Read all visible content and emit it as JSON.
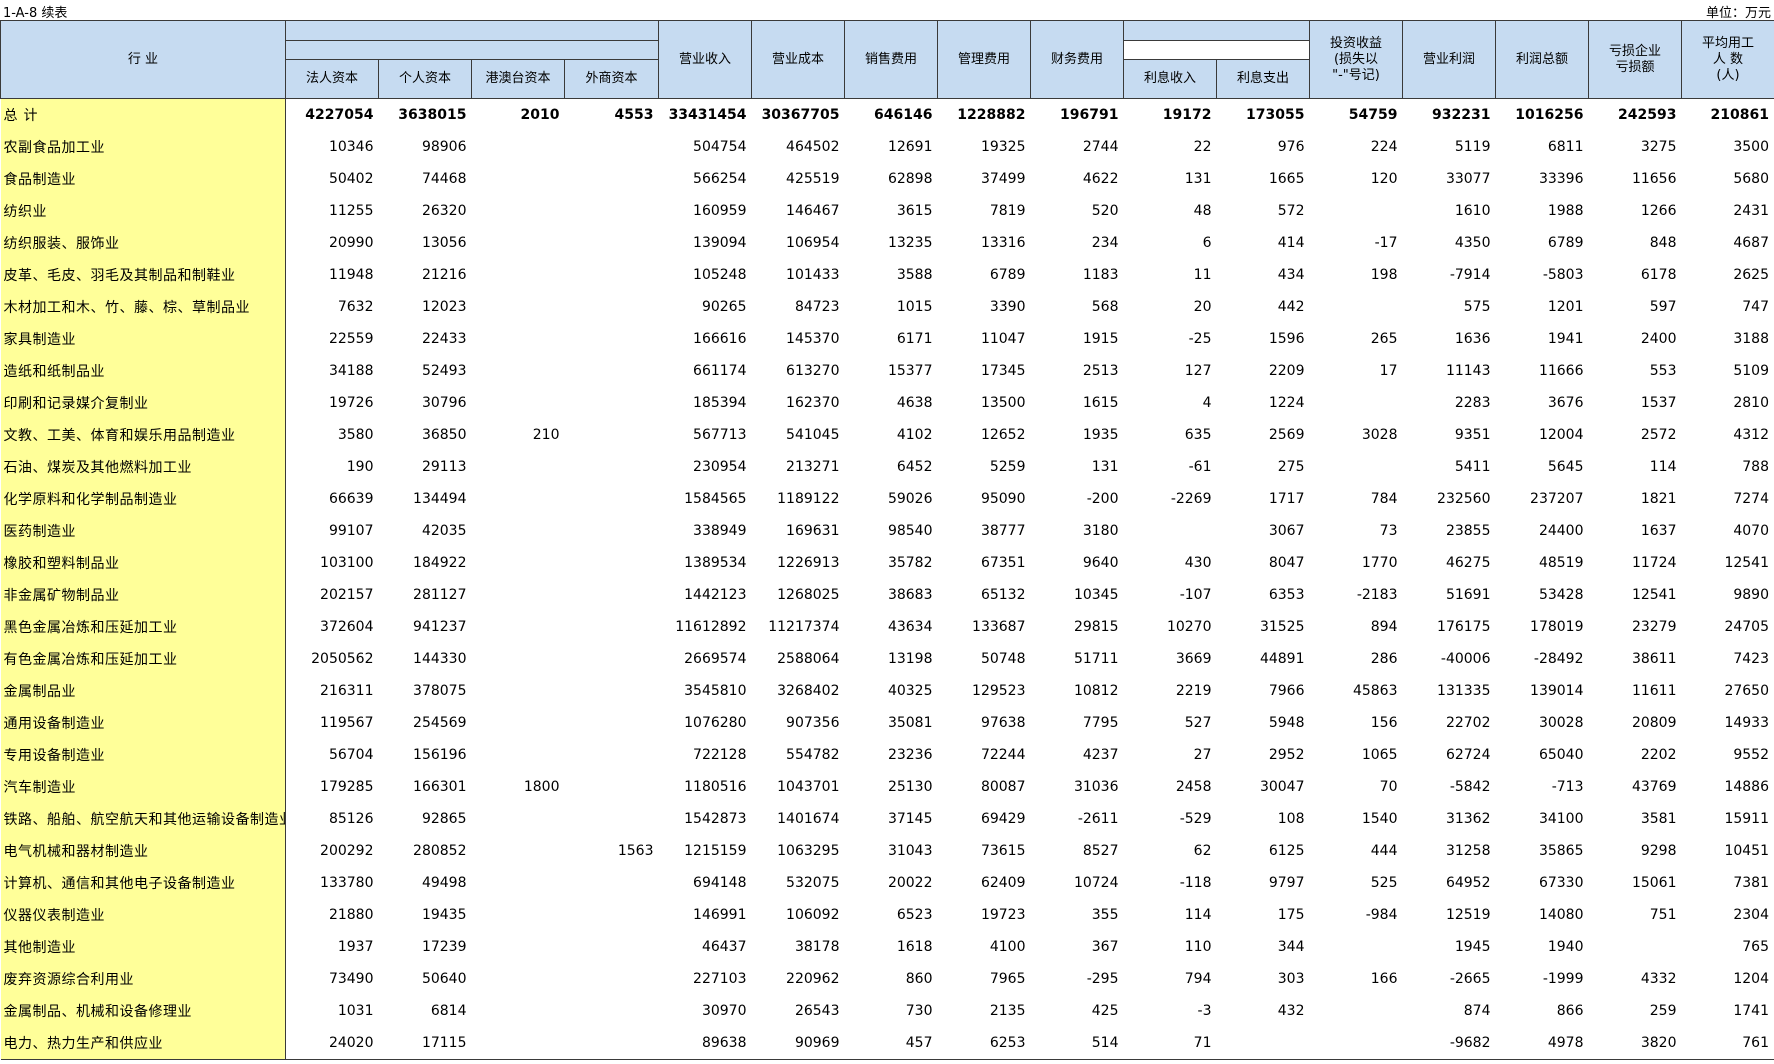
{
  "table_id": "1-A-8  续表",
  "unit": "单位：万元",
  "headers": {
    "industry": "行  业",
    "sub": [
      "法人资本",
      "个人资本",
      "港澳台资本",
      "外商资本"
    ],
    "revenue": "营业收入",
    "cost": "营业成本",
    "sales_exp": "销售费用",
    "mgmt_exp": "管理费用",
    "fin_exp": "财务费用",
    "interest_income": "利息收入",
    "interest_exp": "利息支出",
    "invest_line1": "投资收益",
    "invest_line2": "(损失以",
    "invest_line3": "\"-\"号记)",
    "op_profit": "营业利润",
    "total_profit": "利润总额",
    "loss_line1": "亏损企业",
    "loss_line2": "亏损额",
    "emp_line1": "平均用工",
    "emp_line2": "人  数",
    "emp_line3": "(人)"
  },
  "rows": [
    [
      "总计",
      "4227054",
      "3638015",
      "2010",
      "4553",
      "33431454",
      "30367705",
      "646146",
      "1228882",
      "196791",
      "19172",
      "173055",
      "54759",
      "932231",
      "1016256",
      "242593",
      "210861"
    ],
    [
      "农副食品加工业",
      "10346",
      "98906",
      "",
      "",
      "504754",
      "464502",
      "12691",
      "19325",
      "2744",
      "22",
      "976",
      "224",
      "5119",
      "6811",
      "3275",
      "3500"
    ],
    [
      "食品制造业",
      "50402",
      "74468",
      "",
      "",
      "566254",
      "425519",
      "62898",
      "37499",
      "4622",
      "131",
      "1665",
      "120",
      "33077",
      "33396",
      "11656",
      "5680"
    ],
    [
      "纺织业",
      "11255",
      "26320",
      "",
      "",
      "160959",
      "146467",
      "3615",
      "7819",
      "520",
      "48",
      "572",
      "",
      "1610",
      "1988",
      "1266",
      "2431"
    ],
    [
      "纺织服装、服饰业",
      "20990",
      "13056",
      "",
      "",
      "139094",
      "106954",
      "13235",
      "13316",
      "234",
      "6",
      "414",
      "-17",
      "4350",
      "6789",
      "848",
      "4687"
    ],
    [
      "皮革、毛皮、羽毛及其制品和制鞋业",
      "11948",
      "21216",
      "",
      "",
      "105248",
      "101433",
      "3588",
      "6789",
      "1183",
      "11",
      "434",
      "198",
      "-7914",
      "-5803",
      "6178",
      "2625"
    ],
    [
      "木材加工和木、竹、藤、棕、草制品业",
      "7632",
      "12023",
      "",
      "",
      "90265",
      "84723",
      "1015",
      "3390",
      "568",
      "20",
      "442",
      "",
      "575",
      "1201",
      "597",
      "747"
    ],
    [
      "家具制造业",
      "22559",
      "22433",
      "",
      "",
      "166616",
      "145370",
      "6171",
      "11047",
      "1915",
      "-25",
      "1596",
      "265",
      "1636",
      "1941",
      "2400",
      "3188"
    ],
    [
      "造纸和纸制品业",
      "34188",
      "52493",
      "",
      "",
      "661174",
      "613270",
      "15377",
      "17345",
      "2513",
      "127",
      "2209",
      "17",
      "11143",
      "11666",
      "553",
      "5109"
    ],
    [
      "印刷和记录媒介复制业",
      "19726",
      "30796",
      "",
      "",
      "185394",
      "162370",
      "4638",
      "13500",
      "1615",
      "4",
      "1224",
      "",
      "2283",
      "3676",
      "1537",
      "2810"
    ],
    [
      "文教、工美、体育和娱乐用品制造业",
      "3580",
      "36850",
      "210",
      "",
      "567713",
      "541045",
      "4102",
      "12652",
      "1935",
      "635",
      "2569",
      "3028",
      "9351",
      "12004",
      "2572",
      "4312"
    ],
    [
      "石油、煤炭及其他燃料加工业",
      "190",
      "29113",
      "",
      "",
      "230954",
      "213271",
      "6452",
      "5259",
      "131",
      "-61",
      "275",
      "",
      "5411",
      "5645",
      "114",
      "788"
    ],
    [
      "化学原料和化学制品制造业",
      "66639",
      "134494",
      "",
      "",
      "1584565",
      "1189122",
      "59026",
      "95090",
      "-200",
      "-2269",
      "1717",
      "784",
      "232560",
      "237207",
      "1821",
      "7274"
    ],
    [
      "医药制造业",
      "99107",
      "42035",
      "",
      "",
      "338949",
      "169631",
      "98540",
      "38777",
      "3180",
      "",
      "3067",
      "73",
      "23855",
      "24400",
      "1637",
      "4070"
    ],
    [
      "橡胶和塑料制品业",
      "103100",
      "184922",
      "",
      "",
      "1389534",
      "1226913",
      "35782",
      "67351",
      "9640",
      "430",
      "8047",
      "1770",
      "46275",
      "48519",
      "11724",
      "12541"
    ],
    [
      "非金属矿物制品业",
      "202157",
      "281127",
      "",
      "",
      "1442123",
      "1268025",
      "38683",
      "65132",
      "10345",
      "-107",
      "6353",
      "-2183",
      "51691",
      "53428",
      "12541",
      "9890"
    ],
    [
      "黑色金属冶炼和压延加工业",
      "372604",
      "941237",
      "",
      "",
      "11612892",
      "11217374",
      "43634",
      "133687",
      "29815",
      "10270",
      "31525",
      "894",
      "176175",
      "178019",
      "23279",
      "24705"
    ],
    [
      "有色金属冶炼和压延加工业",
      "2050562",
      "144330",
      "",
      "",
      "2669574",
      "2588064",
      "13198",
      "50748",
      "51711",
      "3669",
      "44891",
      "286",
      "-40006",
      "-28492",
      "38611",
      "7423"
    ],
    [
      "金属制品业",
      "216311",
      "378075",
      "",
      "",
      "3545810",
      "3268402",
      "40325",
      "129523",
      "10812",
      "2219",
      "7966",
      "45863",
      "131335",
      "139014",
      "11611",
      "27650"
    ],
    [
      "通用设备制造业",
      "119567",
      "254569",
      "",
      "",
      "1076280",
      "907356",
      "35081",
      "97638",
      "7795",
      "527",
      "5948",
      "156",
      "22702",
      "30028",
      "20809",
      "14933"
    ],
    [
      "专用设备制造业",
      "56704",
      "156196",
      "",
      "",
      "722128",
      "554782",
      "23236",
      "72244",
      "4237",
      "27",
      "2952",
      "1065",
      "62724",
      "65040",
      "2202",
      "9552"
    ],
    [
      "汽车制造业",
      "179285",
      "166301",
      "1800",
      "",
      "1180516",
      "1043701",
      "25130",
      "80087",
      "31036",
      "2458",
      "30047",
      "70",
      "-5842",
      "-713",
      "43769",
      "14886"
    ],
    [
      "铁路、船舶、航空航天和其他运输设备制造业",
      "85126",
      "92865",
      "",
      "",
      "1542873",
      "1401674",
      "37145",
      "69429",
      "-2611",
      "-529",
      "108",
      "1540",
      "31362",
      "34100",
      "3581",
      "15911"
    ],
    [
      "电气机械和器材制造业",
      "200292",
      "280852",
      "",
      "1563",
      "1215159",
      "1063295",
      "31043",
      "73615",
      "8527",
      "62",
      "6125",
      "444",
      "31258",
      "35865",
      "9298",
      "10451"
    ],
    [
      "计算机、通信和其他电子设备制造业",
      "133780",
      "49498",
      "",
      "",
      "694148",
      "532075",
      "20022",
      "62409",
      "10724",
      "-118",
      "9797",
      "525",
      "64952",
      "67330",
      "15061",
      "7381"
    ],
    [
      "仪器仪表制造业",
      "21880",
      "19435",
      "",
      "",
      "146991",
      "106092",
      "6523",
      "19723",
      "355",
      "114",
      "175",
      "-984",
      "12519",
      "14080",
      "751",
      "2304"
    ],
    [
      "其他制造业",
      "1937",
      "17239",
      "",
      "",
      "46437",
      "38178",
      "1618",
      "4100",
      "367",
      "110",
      "344",
      "",
      "1945",
      "1940",
      "",
      "765"
    ],
    [
      "废弃资源综合利用业",
      "73490",
      "50640",
      "",
      "",
      "227103",
      "220962",
      "860",
      "7965",
      "-295",
      "794",
      "303",
      "166",
      "-2665",
      "-1999",
      "4332",
      "1204"
    ],
    [
      "金属制品、机械和设备修理业",
      "1031",
      "6814",
      "",
      "",
      "30970",
      "26543",
      "730",
      "2135",
      "425",
      "-3",
      "432",
      "",
      "874",
      "866",
      "259",
      "1741"
    ],
    [
      "电力、热力生产和供应业",
      "24020",
      "17115",
      "",
      "",
      "89638",
      "90969",
      "457",
      "6253",
      "514",
      "71",
      "",
      "",
      "-9682",
      "4978",
      "3820",
      "761"
    ]
  ]
}
